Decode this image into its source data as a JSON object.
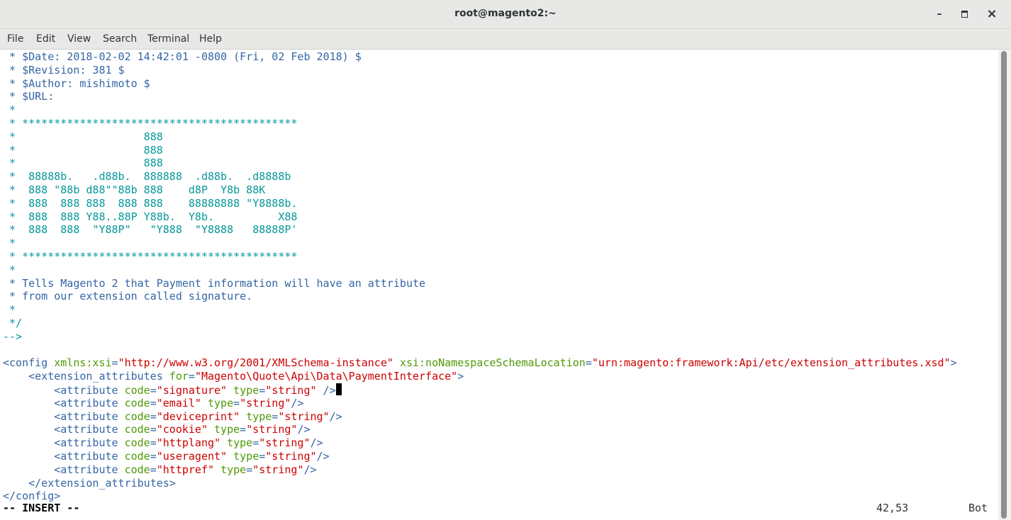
{
  "window": {
    "title": "root@magento2:~",
    "minimize_label": "–",
    "maximize_icon": "maximize-icon",
    "close_label": "×"
  },
  "menu": [
    "File",
    "Edit",
    "View",
    "Search",
    "Terminal",
    "Help"
  ],
  "terminal": {
    "lines": [
      [
        [
          "cm",
          " * $Date: 2018-02-02 14:42:01 -0800 (Fri, 02 Feb 2018) $"
        ]
      ],
      [
        [
          "cm",
          " * $Revision: 381 $"
        ]
      ],
      [
        [
          "cm",
          " * $Author: mishimoto $"
        ]
      ],
      [
        [
          "cm",
          " * $URL:"
        ]
      ],
      [
        [
          "cy",
          " *"
        ]
      ],
      [
        [
          "cy",
          " * *******************************************"
        ]
      ],
      [
        [
          "cy",
          " *                    888"
        ]
      ],
      [
        [
          "cy",
          " *                    888"
        ]
      ],
      [
        [
          "cy",
          " *                    888"
        ]
      ],
      [
        [
          "cy",
          " *  88888b.   .d88b.  888888  .d88b.  .d8888b"
        ]
      ],
      [
        [
          "cy",
          " *  888 \"88b d88\"\"88b 888    d8P  Y8b 88K"
        ]
      ],
      [
        [
          "cy",
          " *  888  888 888  888 888    88888888 \"Y8888b."
        ]
      ],
      [
        [
          "cy",
          " *  888  888 Y88..88P Y88b.  Y8b.          X88"
        ]
      ],
      [
        [
          "cy",
          " *  888  888  \"Y88P\"   \"Y888  \"Y8888   88888P'"
        ]
      ],
      [
        [
          "cy",
          " *"
        ]
      ],
      [
        [
          "cy",
          " * *******************************************"
        ]
      ],
      [
        [
          "cy",
          " *"
        ]
      ],
      [
        [
          "cm",
          " * Tells Magento 2 that Payment information will have an attribute"
        ]
      ],
      [
        [
          "cm",
          " * from our extension called signature."
        ]
      ],
      [
        [
          "cy",
          " *"
        ]
      ],
      [
        [
          "cy",
          " */"
        ]
      ],
      [
        [
          "cy",
          "-->"
        ]
      ],
      [],
      [
        [
          "tg",
          "<config "
        ],
        [
          "at",
          "xmlns:xsi"
        ],
        [
          "tg",
          "="
        ],
        [
          "st",
          "\"http://www.w3.org/2001/XMLSchema-instance\""
        ],
        [
          "tg",
          " "
        ],
        [
          "at",
          "xsi:noNamespaceSchemaLocation"
        ],
        [
          "tg",
          "="
        ],
        [
          "st",
          "\"urn:magento:framework:Api/etc/extension_attributes.xsd\""
        ],
        [
          "tg",
          ">"
        ]
      ],
      [
        [
          "tg",
          "    <extension_attributes "
        ],
        [
          "at",
          "for"
        ],
        [
          "tg",
          "="
        ],
        [
          "st",
          "\"Magento\\Quote\\Api\\Data\\PaymentInterface\""
        ],
        [
          "tg",
          ">"
        ]
      ],
      [
        [
          "tg",
          "        <attribute "
        ],
        [
          "at",
          "code"
        ],
        [
          "tg",
          "="
        ],
        [
          "st",
          "\"signature\""
        ],
        [
          "tg",
          " "
        ],
        [
          "at",
          "type"
        ],
        [
          "tg",
          "="
        ],
        [
          "st",
          "\"string\""
        ],
        [
          "tg",
          " />"
        ]
      ],
      [
        [
          "tg",
          "        <attribute "
        ],
        [
          "at",
          "code"
        ],
        [
          "tg",
          "="
        ],
        [
          "st",
          "\"email\""
        ],
        [
          "tg",
          " "
        ],
        [
          "at",
          "type"
        ],
        [
          "tg",
          "="
        ],
        [
          "st",
          "\"string\""
        ],
        [
          "tg",
          "/>"
        ]
      ],
      [
        [
          "tg",
          "        <attribute "
        ],
        [
          "at",
          "code"
        ],
        [
          "tg",
          "="
        ],
        [
          "st",
          "\"deviceprint\""
        ],
        [
          "tg",
          " "
        ],
        [
          "at",
          "type"
        ],
        [
          "tg",
          "="
        ],
        [
          "st",
          "\"string\""
        ],
        [
          "tg",
          "/>"
        ]
      ],
      [
        [
          "tg",
          "        <attribute "
        ],
        [
          "at",
          "code"
        ],
        [
          "tg",
          "="
        ],
        [
          "st",
          "\"cookie\""
        ],
        [
          "tg",
          " "
        ],
        [
          "at",
          "type"
        ],
        [
          "tg",
          "="
        ],
        [
          "st",
          "\"string\""
        ],
        [
          "tg",
          "/>"
        ]
      ],
      [
        [
          "tg",
          "        <attribute "
        ],
        [
          "at",
          "code"
        ],
        [
          "tg",
          "="
        ],
        [
          "st",
          "\"httplang\""
        ],
        [
          "tg",
          " "
        ],
        [
          "at",
          "type"
        ],
        [
          "tg",
          "="
        ],
        [
          "st",
          "\"string\""
        ],
        [
          "tg",
          "/>"
        ]
      ],
      [
        [
          "tg",
          "        <attribute "
        ],
        [
          "at",
          "code"
        ],
        [
          "tg",
          "="
        ],
        [
          "st",
          "\"useragent\""
        ],
        [
          "tg",
          " "
        ],
        [
          "at",
          "type"
        ],
        [
          "tg",
          "="
        ],
        [
          "st",
          "\"string\""
        ],
        [
          "tg",
          "/>"
        ]
      ],
      [
        [
          "tg",
          "        <attribute "
        ],
        [
          "at",
          "code"
        ],
        [
          "tg",
          "="
        ],
        [
          "st",
          "\"httpref\""
        ],
        [
          "tg",
          " "
        ],
        [
          "at",
          "type"
        ],
        [
          "tg",
          "="
        ],
        [
          "st",
          "\"string\""
        ],
        [
          "tg",
          "/>"
        ]
      ],
      [
        [
          "tg",
          "    </extension_attributes>"
        ]
      ],
      [
        [
          "tg",
          "</config>"
        ]
      ]
    ],
    "cursor": {
      "line": 26,
      "column": 53
    },
    "status": {
      "mode": "-- INSERT --",
      "position": "42,53",
      "scroll": "Bot"
    }
  },
  "colors": {
    "comment": "#3465a4",
    "decoration": "#06989a",
    "tag": "#3465a4",
    "attribute": "#4e9a06",
    "string": "#cc0000"
  }
}
